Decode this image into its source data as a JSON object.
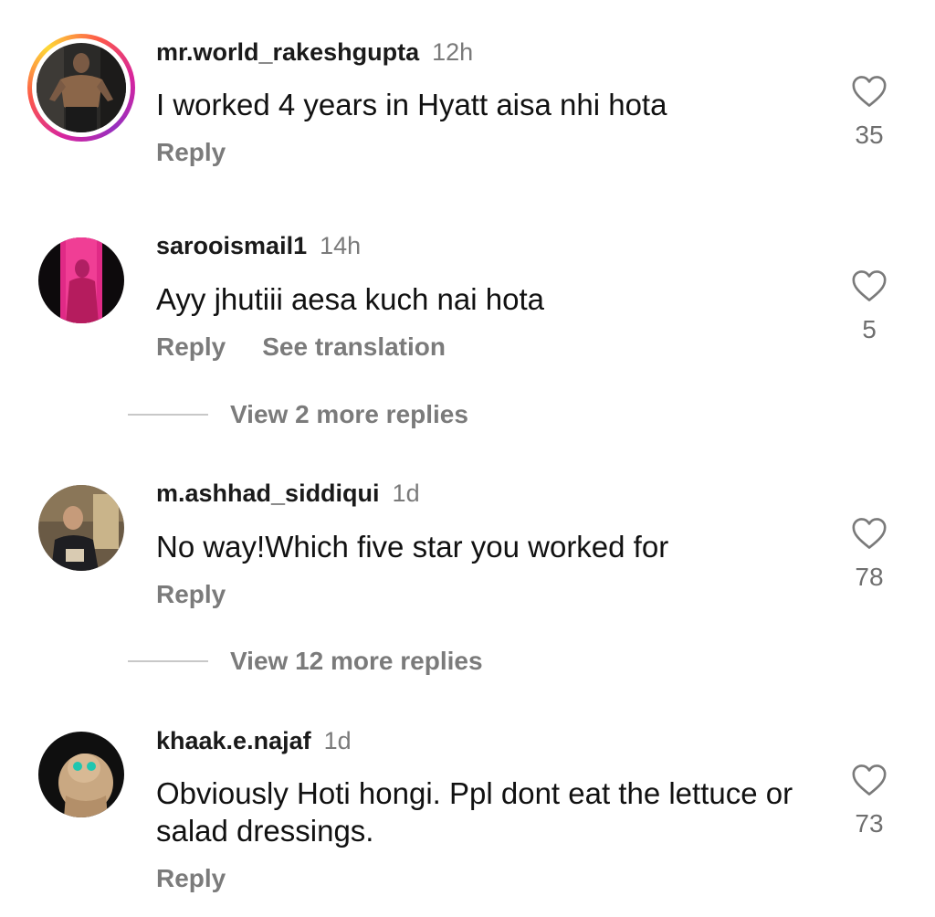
{
  "comments": [
    {
      "username": "mr.world_rakeshgupta",
      "time": "12h",
      "text": "I worked 4 years in Hyatt aisa nhi hota",
      "reply_label": "Reply",
      "likes": "35",
      "has_story_ring": true
    },
    {
      "username": "sarooismail1",
      "time": "14h",
      "text": "Ayy jhutiii aesa kuch nai hota",
      "reply_label": "Reply",
      "translate_label": "See translation",
      "likes": "5",
      "view_replies": "View 2 more replies"
    },
    {
      "username": "m.ashhad_siddiqui",
      "time": "1d",
      "text": "No way!Which five star you worked for",
      "reply_label": "Reply",
      "likes": "78",
      "view_replies": "View 12 more replies"
    },
    {
      "username": "khaak.e.najaf",
      "time": "1d",
      "text": "Obviously Hoti hongi. Ppl dont eat the lettuce or salad dressings.",
      "reply_label": "Reply",
      "likes": "73"
    }
  ],
  "icons": {
    "like": "heart-outline-icon"
  },
  "colors": {
    "secondary_text": "#7b7b7b",
    "divider": "#c8c8c8",
    "story_ring": "#d6249f"
  }
}
